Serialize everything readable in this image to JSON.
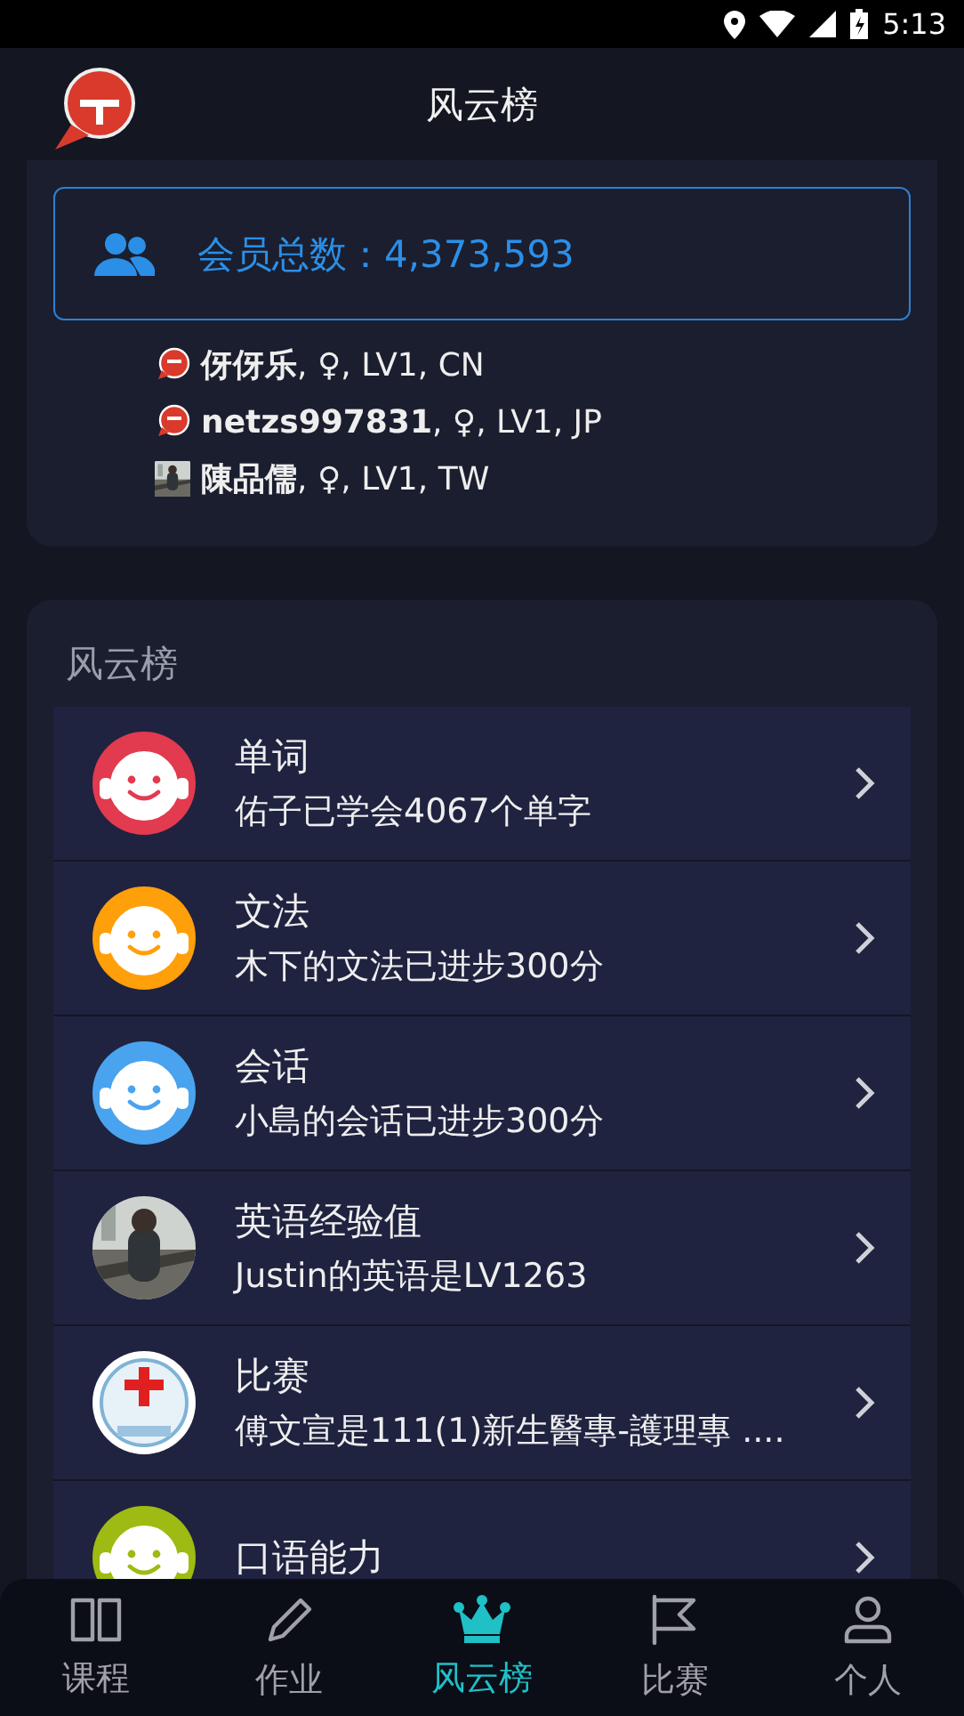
{
  "status_bar": {
    "time": "5:13"
  },
  "header": {
    "title": "风云榜"
  },
  "members": {
    "label": "会员总数：",
    "count": "4,373,593",
    "list": [
      {
        "kind": "logo",
        "text": "**伢伢乐**, ♀, LV1, CN"
      },
      {
        "kind": "logo",
        "text": "**netzs997831**, ♀, LV1, JP"
      },
      {
        "kind": "picture",
        "text": "**陳品儒**, ♀, LV1, TW"
      }
    ]
  },
  "ranking": {
    "title": "风云榜",
    "rows": [
      {
        "kind": "face",
        "color": "#e23a4f",
        "title": "单词",
        "subtitle": "佑子已学会4067个单字"
      },
      {
        "kind": "face",
        "color": "#ff9f0a",
        "title": "文法",
        "subtitle": "木下的文法已进步300分"
      },
      {
        "kind": "face",
        "color": "#4aa3ee",
        "title": "会话",
        "subtitle": "小島的会话已进步300分"
      },
      {
        "kind": "picture",
        "title": "英语经验值",
        "subtitle": "Justin的英语是LV1263"
      },
      {
        "kind": "emblem",
        "title": "比赛",
        "subtitle": "傅文宣是111(1)新生醫專-護理專 ...."
      },
      {
        "kind": "face",
        "color": "#9dbb12",
        "title": "口语能力"
      }
    ]
  },
  "tabs": [
    {
      "kind": "book",
      "label": "课程",
      "selected": false
    },
    {
      "kind": "pencil",
      "label": "作业",
      "selected": false
    },
    {
      "kind": "crown",
      "label": "风云榜",
      "selected": true
    },
    {
      "kind": "flag",
      "label": "比赛",
      "selected": false
    },
    {
      "kind": "person",
      "label": "个人",
      "selected": false
    }
  ]
}
